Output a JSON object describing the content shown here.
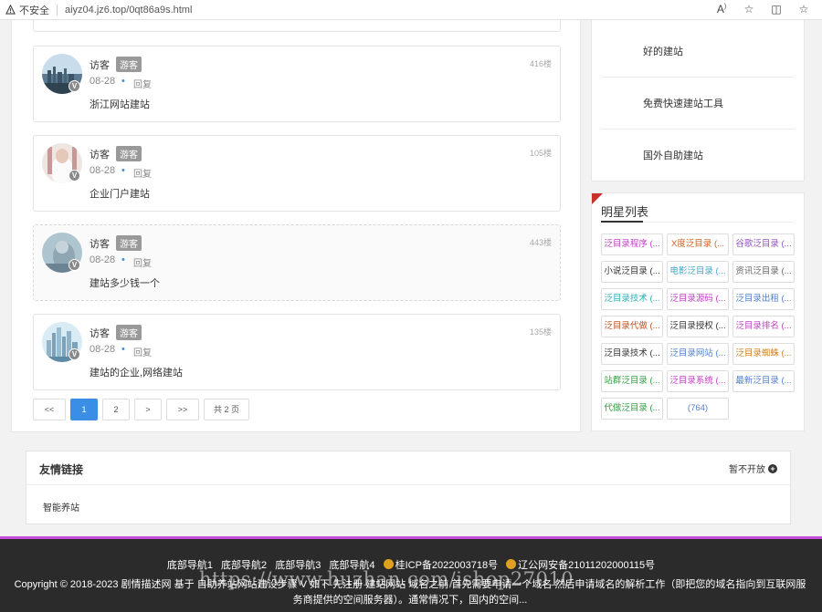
{
  "browser": {
    "security_label": "不安全",
    "url": "aiyz04.jz6.top/0qt86a9s.html",
    "tools": [
      "read-aloud-icon",
      "favorite-icon",
      "split-screen-icon",
      "collections-icon"
    ]
  },
  "comments": [
    {
      "user": "访客",
      "tag": "游客",
      "floor": "416楼",
      "date": "08-28",
      "reply": "回复",
      "text": "浙江网站建站"
    },
    {
      "user": "访客",
      "tag": "游客",
      "floor": "105楼",
      "date": "08-28",
      "reply": "回复",
      "text": "企业门户建站"
    },
    {
      "user": "访客",
      "tag": "游客",
      "floor": "443楼",
      "date": "08-28",
      "reply": "回复",
      "text": "建站多少钱一个"
    },
    {
      "user": "访客",
      "tag": "游客",
      "floor": "135楼",
      "date": "08-28",
      "reply": "回复",
      "text": "建站的企业,网络建站"
    }
  ],
  "pager": {
    "first": "<<",
    "pages": [
      "1",
      "2"
    ],
    "active": "1",
    "next": ">",
    "last": ">>",
    "total": "共 2 页"
  },
  "sidebar": {
    "items": [
      "好的建站",
      "免费快速建站工具",
      "国外自助建站"
    ]
  },
  "stars": {
    "title": "明星列表",
    "chips": [
      {
        "label": "泛目录程序 (...",
        "color": "#c040c0"
      },
      {
        "label": "X度泛目录 (...",
        "color": "#d06020"
      },
      {
        "label": "谷歌泛目录 (...",
        "color": "#9050c0"
      },
      {
        "label": "小说泛目录 (...",
        "color": "#333333"
      },
      {
        "label": "电影泛目录 (...",
        "color": "#3fa8c8"
      },
      {
        "label": "资讯泛目录 (...",
        "color": "#666666"
      },
      {
        "label": "泛目录技术 (...",
        "color": "#2ab0b8"
      },
      {
        "label": "泛目录源码 (...",
        "color": "#c040c0"
      },
      {
        "label": "泛目录出租 (...",
        "color": "#5080d0"
      },
      {
        "label": "泛目录代做 (...",
        "color": "#c05020"
      },
      {
        "label": "泛目录授权 (...",
        "color": "#333333"
      },
      {
        "label": "泛目录排名 (...",
        "color": "#c040c0"
      },
      {
        "label": "泛目录技术 (...",
        "color": "#333333"
      },
      {
        "label": "泛目录网站 (...",
        "color": "#5080d0"
      },
      {
        "label": "泛目录蜘蛛 (...",
        "color": "#d08020"
      },
      {
        "label": "站群泛目录 (...",
        "color": "#30a040"
      },
      {
        "label": "泛目录系统 (...",
        "color": "#c040c0"
      },
      {
        "label": "最新泛目录 (...",
        "color": "#5080d0"
      },
      {
        "label": "代做泛目录 (...",
        "color": "#30a040"
      },
      {
        "label": "(764)",
        "color": "#5080d0"
      }
    ]
  },
  "links": {
    "title": "友情链接",
    "more": "暂不开放",
    "items": [
      "智能养站"
    ]
  },
  "footer": {
    "nav": [
      "底部导航1",
      "底部导航2",
      "底部导航3",
      "底部导航4"
    ],
    "icp": "桂ICP备2022003718号",
    "police": "辽公网安备21011202000115号",
    "copyright": "Copyright © 2018-2023 剧情描述网 基于 自助养站网站建设步骤 V 如下 先注册 建站网站 域名之前 首先需要申请一个域名 然后申请域名的解析工作（即把您的域名指向到互联网服务商提供的空间服务器）。通常情况下，国内的空间...",
    "watermark": "https://www.huzhan.com/ishop27010"
  }
}
